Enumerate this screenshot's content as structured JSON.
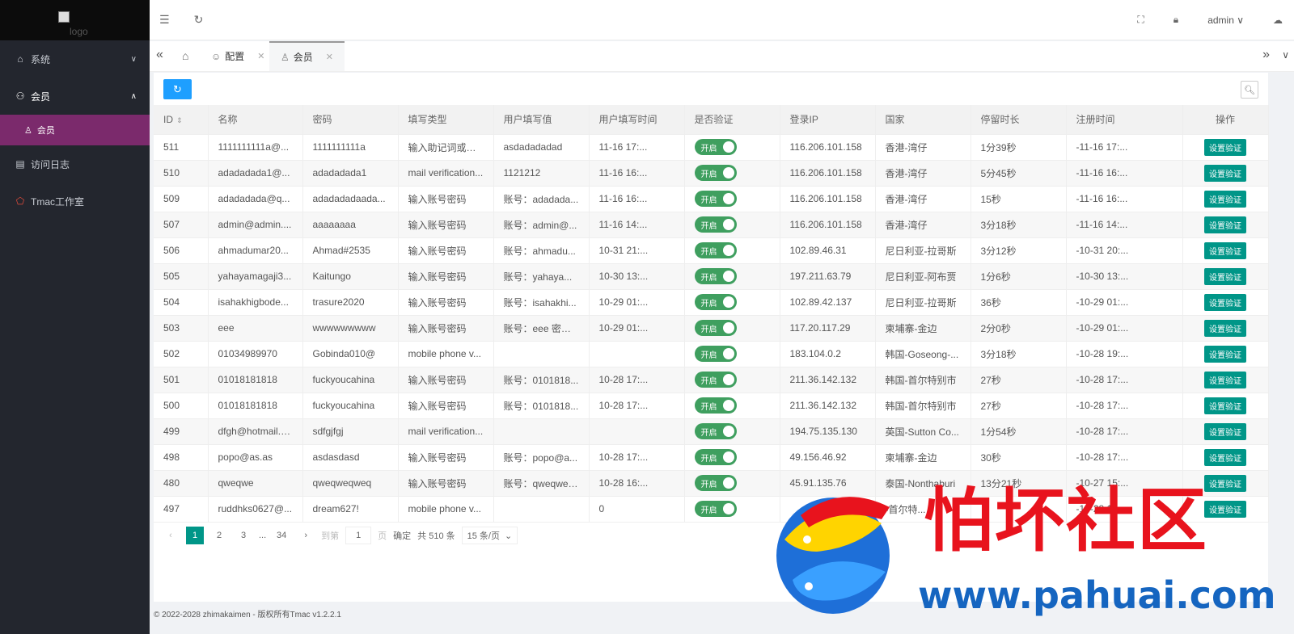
{
  "sidebar": {
    "logo_alt": "logo",
    "items": [
      {
        "label": "系统"
      },
      {
        "label": "会员"
      },
      {
        "label": "会员"
      },
      {
        "label": "访问日志"
      },
      {
        "label": "Tmac工作室"
      }
    ]
  },
  "header": {
    "user": "admin"
  },
  "tabs": [
    {
      "label": "配置"
    },
    {
      "label": "会员"
    }
  ],
  "table": {
    "columns": [
      "ID",
      "名称",
      "密码",
      "填写类型",
      "用户填写值",
      "用户填写时间",
      "是否验证",
      "登录IP",
      "国家",
      "停留时长",
      "注册时间",
      "操作"
    ],
    "switch_label": "开启",
    "action_label": "设置验证",
    "rows": [
      [
        "511",
        "1111111111a@...",
        "1111111111a",
        "输入助记词或密...",
        "asdadadadad",
        "11-16 17:...",
        "116.206.101.158",
        "香港-湾仔",
        "1分39秒",
        "-11-16 17:..."
      ],
      [
        "510",
        "adadadada1@...",
        "adadadada1",
        "mail verification...",
        "1121212",
        "11-16 16:...",
        "116.206.101.158",
        "香港-湾仔",
        "5分45秒",
        "-11-16 16:..."
      ],
      [
        "509",
        "adadadada@q...",
        "adadadadaada...",
        "输入账号密码",
        "账号：adadada...",
        "11-16 16:...",
        "116.206.101.158",
        "香港-湾仔",
        "15秒",
        "-11-16 16:..."
      ],
      [
        "507",
        "admin@admin....",
        "aaaaaaaa",
        "输入账号密码",
        "账号：admin@...",
        "11-16 14:...",
        "116.206.101.158",
        "香港-湾仔",
        "3分18秒",
        "-11-16 14:..."
      ],
      [
        "506",
        "ahmadumar20...",
        "Ahmad#2535",
        "输入账号密码",
        "账号：ahmadu...",
        "10-31 21:...",
        "102.89.46.31",
        "尼日利亚-拉哥斯",
        "3分12秒",
        "-10-31 20:..."
      ],
      [
        "505",
        "yahayamagaji3...",
        "Kaitungo",
        "输入账号密码",
        "账号：yahaya...",
        "10-30 13:...",
        "197.211.63.79",
        "尼日利亚-阿布贾",
        "1分6秒",
        "-10-30 13:..."
      ],
      [
        "504",
        "isahakhigbode...",
        "trasure2020",
        "输入账号密码",
        "账号：isahakhi...",
        "10-29 01:...",
        "102.89.42.137",
        "尼日利亚-拉哥斯",
        "36秒",
        "-10-29 01:..."
      ],
      [
        "503",
        "eee",
        "wwwwwwwww",
        "输入账号密码",
        "账号：eee 密码...",
        "10-29 01:...",
        "117.20.117.29",
        "柬埔寨-金边",
        "2分0秒",
        "-10-29 01:..."
      ],
      [
        "502",
        "01034989970",
        "Gobinda010@",
        "mobile phone v...",
        "",
        "",
        "183.104.0.2",
        "韩国-Goseong-...",
        "3分18秒",
        "-10-28 19:..."
      ],
      [
        "501",
        "01018181818",
        "fuckyoucahina",
        "输入账号密码",
        "账号：0101818...",
        "10-28 17:...",
        "211.36.142.132",
        "韩国-首尔特别市",
        "27秒",
        "-10-28 17:..."
      ],
      [
        "500",
        "01018181818",
        "fuckyoucahina",
        "输入账号密码",
        "账号：0101818...",
        "10-28 17:...",
        "211.36.142.132",
        "韩国-首尔特别市",
        "27秒",
        "-10-28 17:..."
      ],
      [
        "499",
        "dfgh@hotmail.c...",
        "sdfgjfgj",
        "mail verification...",
        "",
        "",
        "194.75.135.130",
        "英国-Sutton Co...",
        "1分54秒",
        "-10-28 17:..."
      ],
      [
        "498",
        "popo@as.as",
        "asdasdasd",
        "输入账号密码",
        "账号：popo@a...",
        "10-28 17:...",
        "49.156.46.92",
        "柬埔寨-金边",
        "30秒",
        "-10-28 17:..."
      ],
      [
        "480",
        "qweqwe",
        "qweqweqweq",
        "输入账号密码",
        "账号：qweqwe ...",
        "10-28 16:...",
        "45.91.135.76",
        "泰国-Nonthaburi",
        "13分21秒",
        "-10-27 15:..."
      ],
      [
        "497",
        "ruddhks0627@...",
        "dream627!",
        "mobile phone v...",
        "",
        "0",
        "",
        "-首尔特...",
        "",
        "-10-28 15:..."
      ]
    ]
  },
  "pager": {
    "pages": [
      "1",
      "2",
      "3",
      "34"
    ],
    "ellipsis": "...",
    "goto_label": "到第",
    "goto_value": "1",
    "page_unit": "页",
    "confirm": "确定",
    "total": "共 510 条",
    "page_size": "15 条/页"
  },
  "footer": "© 2022-2028 zhimakaimen - 版权所有Tmac v1.2.2.1",
  "watermark": {
    "title": "怕坏社区",
    "url": "www.pahuai.com"
  }
}
